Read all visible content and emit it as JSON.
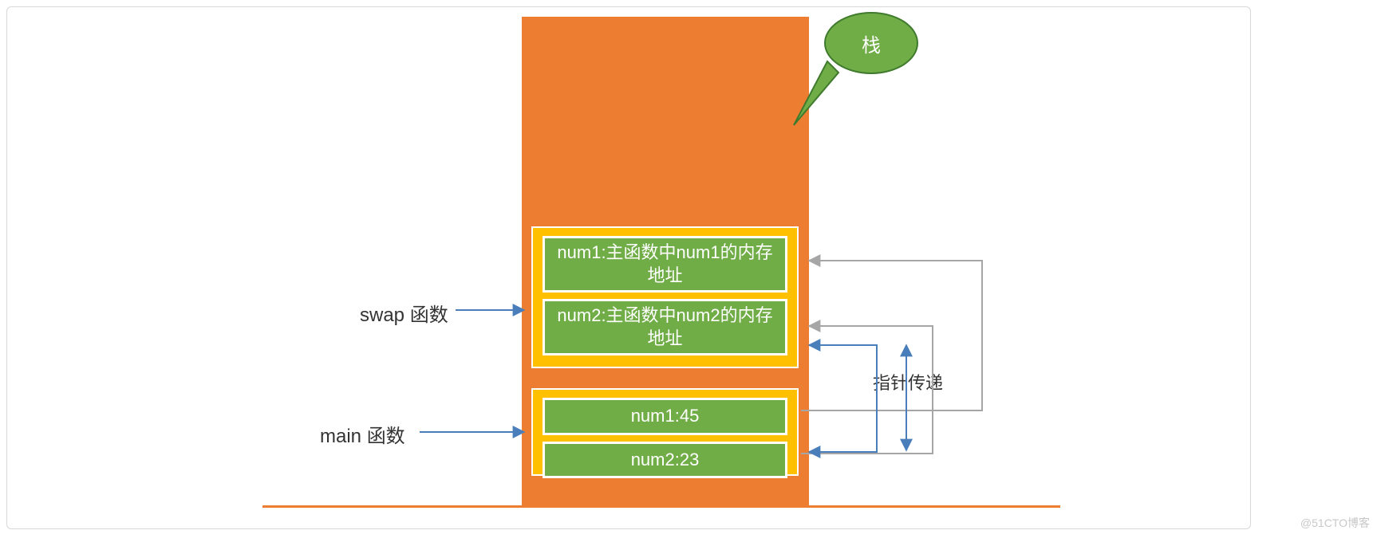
{
  "callout": {
    "text": "栈"
  },
  "labels": {
    "swap": "swap 函数",
    "main": "main 函数",
    "pointer_pass": "指针传递"
  },
  "swap_frame": {
    "slot1": "num1:主函数中num1的内存地址",
    "slot2": "num2:主函数中num2的内存地址"
  },
  "main_frame": {
    "slot1": "num1:45",
    "slot2": "num2:23"
  },
  "watermark": "@51CTO博客"
}
